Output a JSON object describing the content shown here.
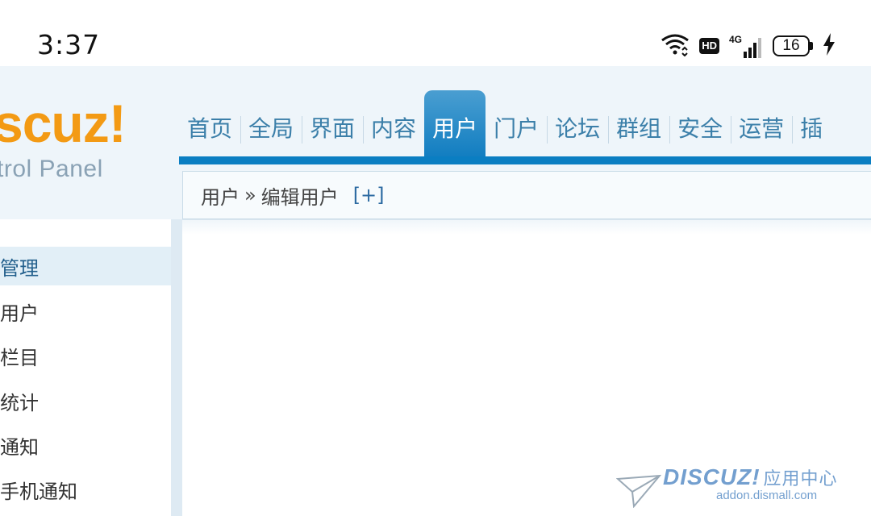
{
  "status_bar": {
    "time": "3:37",
    "hd_label": "HD",
    "network_label": "4G",
    "battery_level": "16",
    "icons": [
      "wifi-icon",
      "hd-icon",
      "signal-4g-icon",
      "battery-icon",
      "charging-bolt-icon"
    ]
  },
  "logo": {
    "main": "scuz!",
    "sub": "trol Panel"
  },
  "nav": {
    "items": [
      {
        "label": "首页"
      },
      {
        "label": "全局"
      },
      {
        "label": "界面"
      },
      {
        "label": "内容"
      },
      {
        "label": "用户"
      },
      {
        "label": "门户"
      },
      {
        "label": "论坛"
      },
      {
        "label": "群组"
      },
      {
        "label": "安全"
      },
      {
        "label": "运营"
      },
      {
        "label": "插"
      }
    ],
    "active_index": 4,
    "active_color": "#0b7abf"
  },
  "breadcrumb": {
    "section": "用户",
    "separator": "»",
    "page": "编辑用户",
    "toggle": "[+]"
  },
  "sidebar": {
    "items": [
      {
        "label": "管理",
        "active": true
      },
      {
        "label": "用户"
      },
      {
        "label": "栏目"
      },
      {
        "label": "统计"
      },
      {
        "label": "通知"
      },
      {
        "label": "手机通知"
      }
    ]
  },
  "watermark": {
    "brand": "DISCUZ!",
    "brand_cn": "应用中心",
    "url": "addon.dismall.com"
  }
}
